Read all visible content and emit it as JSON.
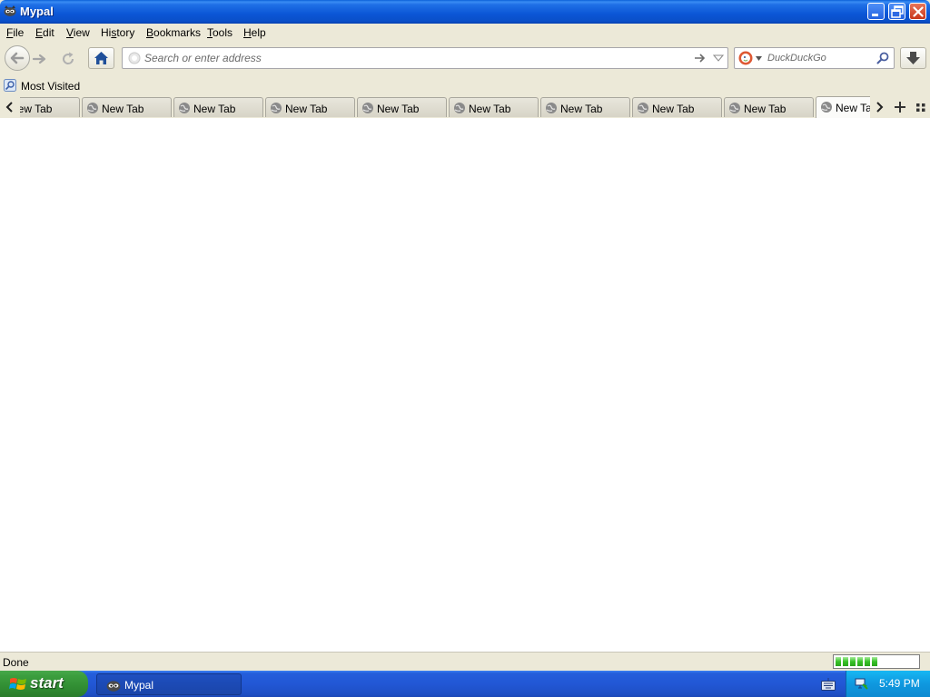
{
  "window": {
    "title": "Mypal"
  },
  "menubar": {
    "items": [
      {
        "label": "File",
        "accesskey": "F"
      },
      {
        "label": "Edit",
        "accesskey": "E"
      },
      {
        "label": "View",
        "accesskey": "V"
      },
      {
        "label": "History",
        "accesskey": "s"
      },
      {
        "label": "Bookmarks",
        "accesskey": "B"
      },
      {
        "label": "Tools",
        "accesskey": "T"
      },
      {
        "label": "Help",
        "accesskey": "H"
      }
    ]
  },
  "navbar": {
    "url_placeholder": "Search or enter address",
    "url_value": "",
    "search_placeholder": "DuckDuckGo",
    "search_engine_icon": "duckduckgo-icon"
  },
  "bookmarks": {
    "items": [
      {
        "label": "Most Visited"
      }
    ]
  },
  "tabs": {
    "items": [
      {
        "label": "New Tab",
        "selected": false
      },
      {
        "label": "New Tab",
        "selected": false
      },
      {
        "label": "New Tab",
        "selected": false
      },
      {
        "label": "New Tab",
        "selected": false
      },
      {
        "label": "New Tab",
        "selected": false
      },
      {
        "label": "New Tab",
        "selected": false
      },
      {
        "label": "New Tab",
        "selected": false
      },
      {
        "label": "New Tab",
        "selected": false
      },
      {
        "label": "New Tab",
        "selected": false
      },
      {
        "label": "New Tab",
        "selected": true
      }
    ]
  },
  "statusbar": {
    "text": "Done",
    "progress_segments_filled": 6,
    "progress_segments_total": 11
  },
  "taskbar": {
    "start_label": "start",
    "task_items": [
      {
        "label": "Mypal",
        "icon": "mypal-icon"
      }
    ],
    "clock": "5:49 PM"
  },
  "colors": {
    "titlebar": "#0a56d6",
    "chrome": "#ece9d8",
    "taskbar": "#245edb",
    "start_button": "#3c9e3e",
    "tray": "#0f98df"
  }
}
